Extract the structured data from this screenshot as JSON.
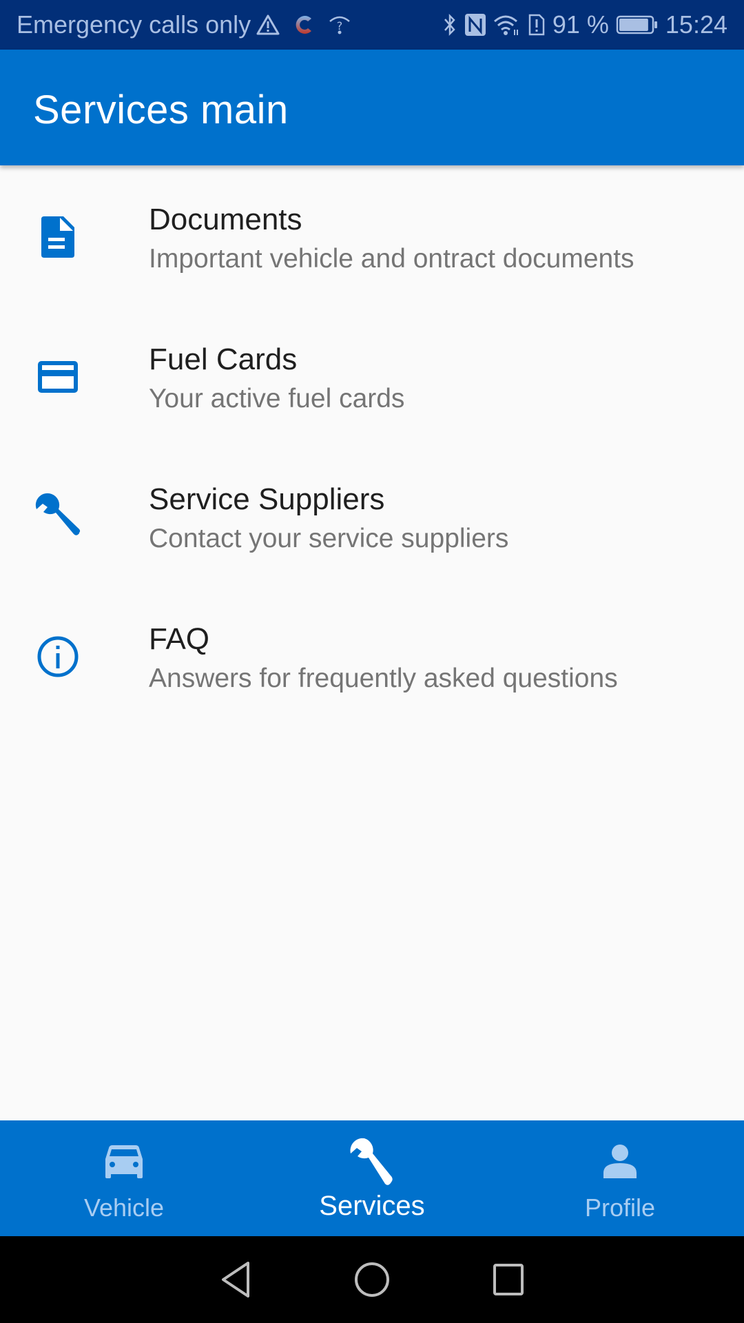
{
  "status_bar": {
    "carrier_text": "Emergency calls only",
    "icons_left": [
      "warning-icon",
      "app-notification-icon",
      "wifi-unknown-icon"
    ],
    "icons_right": [
      "bluetooth-icon",
      "nfc-icon",
      "wifi-icon",
      "sim-alert-icon",
      "battery-icon"
    ],
    "battery_percent_text": "91 %",
    "battery_level": 0.91,
    "time": "15:24"
  },
  "app_bar": {
    "title": "Services main",
    "color": "#0071cc"
  },
  "list": {
    "items": [
      {
        "icon": "document-icon",
        "title": "Documents",
        "subtitle": "Important vehicle and ontract documents"
      },
      {
        "icon": "credit-card-icon",
        "title": "Fuel Cards",
        "subtitle": "Your active fuel cards"
      },
      {
        "icon": "wrench-icon",
        "title": "Service Suppliers",
        "subtitle": "Contact your service suppliers"
      },
      {
        "icon": "info-icon",
        "title": "FAQ",
        "subtitle": "Answers for frequently asked questions"
      }
    ],
    "icon_color": "#0071cc"
  },
  "bottom_nav": {
    "items": [
      {
        "icon": "car-icon",
        "label": "Vehicle",
        "active": false
      },
      {
        "icon": "wrench-icon",
        "label": "Services",
        "active": true
      },
      {
        "icon": "person-icon",
        "label": "Profile",
        "active": false
      }
    ]
  },
  "system_nav": {
    "buttons": [
      "back-icon",
      "home-icon",
      "recents-icon"
    ]
  }
}
